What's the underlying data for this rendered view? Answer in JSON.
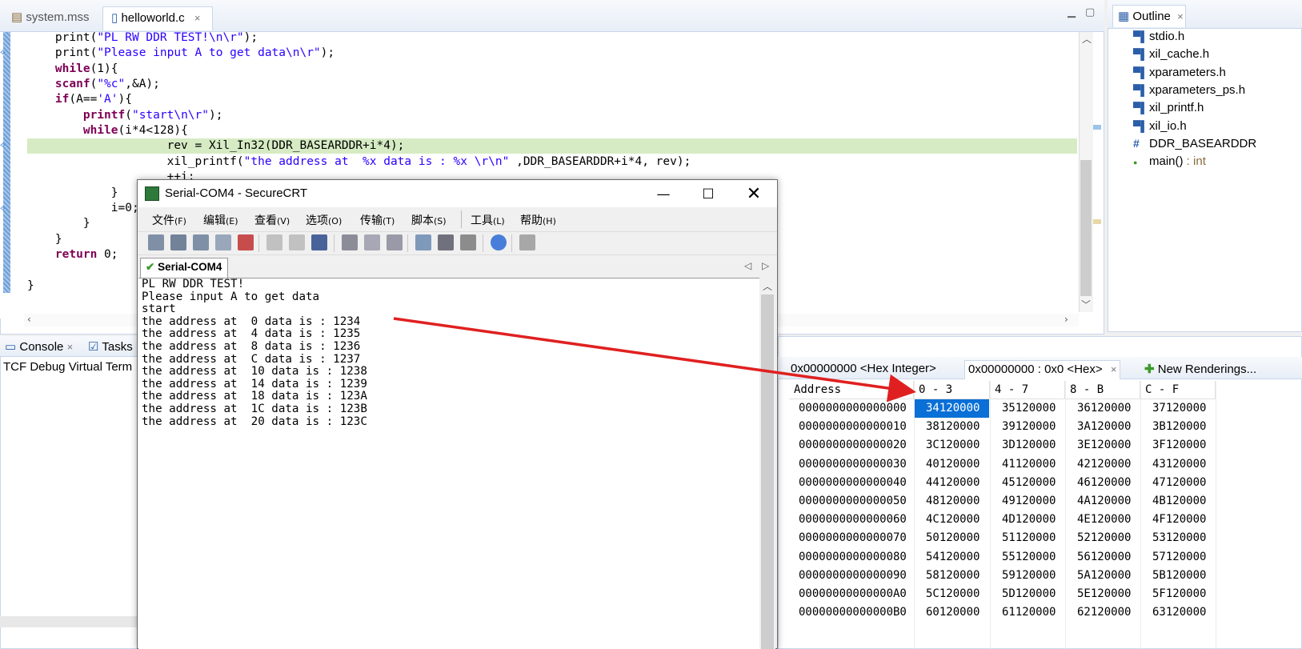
{
  "editor": {
    "tabs": [
      {
        "label": "system.mss"
      },
      {
        "label": "helloworld.c"
      }
    ],
    "close_glyph": "×",
    "code_lines": [
      "    print(\"PL RW DDR TEST!\\n\\r\");",
      "    print(\"Please input A to get data\\n\\r\");",
      "    while(1){",
      "    scanf(\"%c\",&A);",
      "    if(A=='A'){",
      "        printf(\"start\\n\\r\");",
      "        while(i*4<128){",
      "                    rev = Xil_In32(DDR_BASEARDDR+i*4);",
      "                    xil_printf(\"the address at  %x data is : %x \\r\\n\" ,DDR_BASEARDDR+i*4, rev);",
      "                    ++i;",
      "            }",
      "            i=0;",
      "        }",
      "    }",
      "    return 0;",
      "",
      "}"
    ]
  },
  "outline": {
    "title": "Outline",
    "items": [
      {
        "label": "stdio.h",
        "icon": "include-icon"
      },
      {
        "label": "xil_cache.h",
        "icon": "include-icon"
      },
      {
        "label": "xparameters.h",
        "icon": "include-icon"
      },
      {
        "label": "xparameters_ps.h",
        "icon": "include-icon"
      },
      {
        "label": "xil_printf.h",
        "icon": "include-icon"
      },
      {
        "label": "xil_io.h",
        "icon": "include-icon"
      },
      {
        "label": "DDR_BASEARDDR",
        "icon": "macro-icon"
      },
      {
        "label": "main()",
        "type": " : int",
        "icon": "function-icon"
      }
    ]
  },
  "console": {
    "tabs": [
      {
        "label": "Console"
      },
      {
        "label": "Tasks"
      }
    ],
    "content": "TCF Debug Virtual Term"
  },
  "memory": {
    "tabs": [
      {
        "label": "0x00000000 <Hex Integer>"
      },
      {
        "label": "0x00000000 : 0x0 <Hex>"
      },
      {
        "label": "New Renderings..."
      }
    ],
    "headers": [
      "Address",
      "0 - 3",
      "4 - 7",
      "8 - B",
      "C - F"
    ],
    "rows": [
      {
        "address": "0000000000000000",
        "cells": [
          "34120000",
          "35120000",
          "36120000",
          "37120000"
        ]
      },
      {
        "address": "0000000000000010",
        "cells": [
          "38120000",
          "39120000",
          "3A120000",
          "3B120000"
        ]
      },
      {
        "address": "0000000000000020",
        "cells": [
          "3C120000",
          "3D120000",
          "3E120000",
          "3F120000"
        ]
      },
      {
        "address": "0000000000000030",
        "cells": [
          "40120000",
          "41120000",
          "42120000",
          "43120000"
        ]
      },
      {
        "address": "0000000000000040",
        "cells": [
          "44120000",
          "45120000",
          "46120000",
          "47120000"
        ]
      },
      {
        "address": "0000000000000050",
        "cells": [
          "48120000",
          "49120000",
          "4A120000",
          "4B120000"
        ]
      },
      {
        "address": "0000000000000060",
        "cells": [
          "4C120000",
          "4D120000",
          "4E120000",
          "4F120000"
        ]
      },
      {
        "address": "0000000000000070",
        "cells": [
          "50120000",
          "51120000",
          "52120000",
          "53120000"
        ]
      },
      {
        "address": "0000000000000080",
        "cells": [
          "54120000",
          "55120000",
          "56120000",
          "57120000"
        ]
      },
      {
        "address": "0000000000000090",
        "cells": [
          "58120000",
          "59120000",
          "5A120000",
          "5B120000"
        ]
      },
      {
        "address": "00000000000000A0",
        "cells": [
          "5C120000",
          "5D120000",
          "5E120000",
          "5F120000"
        ]
      },
      {
        "address": "00000000000000B0",
        "cells": [
          "60120000",
          "61120000",
          "62120000",
          "63120000"
        ]
      }
    ],
    "selected_cell_color": "#0a6fd6"
  },
  "securecrt": {
    "title": "Serial-COM4 - SecureCRT",
    "menu": [
      {
        "label": "文件",
        "hotkey": "(F)"
      },
      {
        "label": "编辑",
        "hotkey": "(E)"
      },
      {
        "label": "查看",
        "hotkey": "(V)"
      },
      {
        "label": "选项",
        "hotkey": "(O)"
      },
      {
        "label": "传输",
        "hotkey": "(T)"
      },
      {
        "label": "脚本",
        "hotkey": "(S)"
      },
      {
        "label": "工具",
        "hotkey": "(L)"
      },
      {
        "label": "帮助",
        "hotkey": "(H)"
      }
    ],
    "session_tab": "Serial-COM4",
    "terminal_lines": [
      "PL RW DDR TEST!",
      "Please input A to get data",
      "start",
      "the address at  0 data is : 1234",
      "the address at  4 data is : 1235",
      "the address at  8 data is : 1236",
      "the address at  C data is : 1237",
      "the address at  10 data is : 1238",
      "the address at  14 data is : 1239",
      "the address at  18 data is : 123A",
      "the address at  1C data is : 123B",
      "the address at  20 data is : 123C"
    ]
  },
  "colors": {
    "keyword": "#7f0055",
    "string": "#2a00ff",
    "highlight_line": "#d6ebc3",
    "arrow": "#e02020"
  }
}
